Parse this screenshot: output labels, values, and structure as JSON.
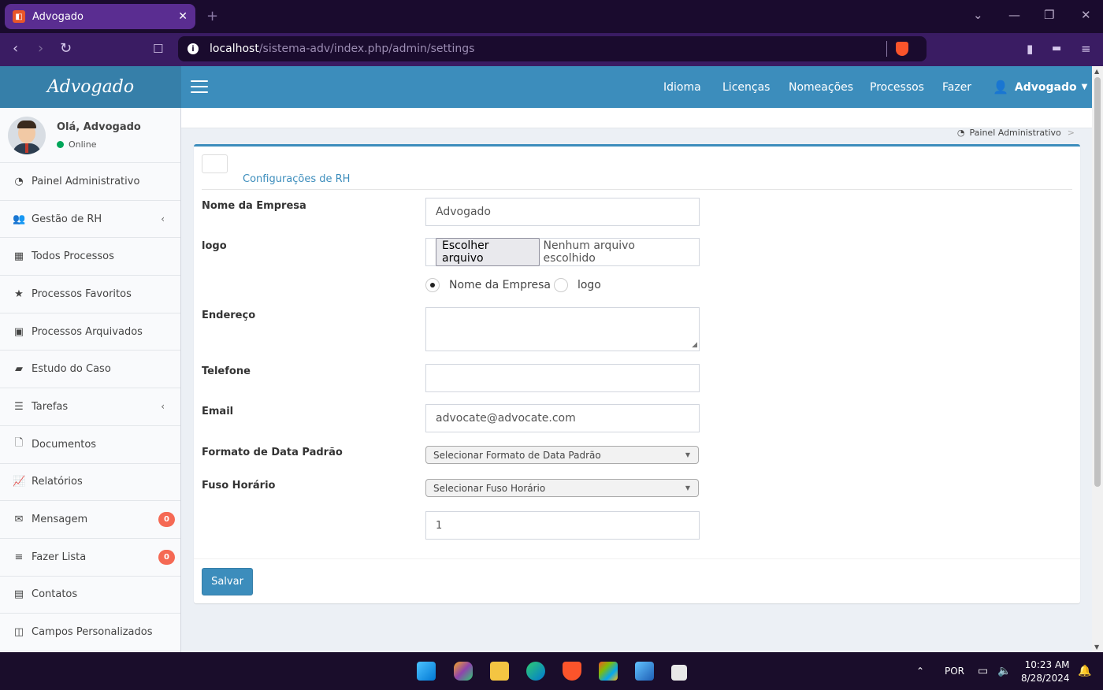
{
  "browser": {
    "tab_title": "Advogado",
    "tab_close": "✕",
    "new_tab": "+",
    "url_host": "localhost",
    "url_path": "/sistema-adv/index.php/admin/settings"
  },
  "app": {
    "brand": "Advogado",
    "nav": [
      "Idioma",
      "Licenças",
      "Nomeações",
      "Processos",
      "Fazer"
    ],
    "user_menu": "Advogado"
  },
  "sidebar": {
    "greeting": "Olá, Advogado",
    "status": "Online",
    "items": [
      {
        "label": "Painel Administrativo",
        "icon": "dashboard-icon"
      },
      {
        "label": "Gestão de RH",
        "icon": "users-icon",
        "expandable": true
      },
      {
        "label": "Todos Processos",
        "icon": "grid-icon"
      },
      {
        "label": "Processos Favoritos",
        "icon": "star-icon"
      },
      {
        "label": "Processos Arquivados",
        "icon": "archive-icon"
      },
      {
        "label": "Estudo do Caso",
        "icon": "book-icon"
      },
      {
        "label": "Tarefas",
        "icon": "tasks-icon",
        "expandable": true
      },
      {
        "label": "Documentos",
        "icon": "file-icon"
      },
      {
        "label": "Relatórios",
        "icon": "line-chart-icon"
      },
      {
        "label": "Mensagem",
        "icon": "envelope-icon",
        "badge": "0"
      },
      {
        "label": "Fazer Lista",
        "icon": "list-icon",
        "badge": "0"
      },
      {
        "label": "Contatos",
        "icon": "address-card-icon"
      },
      {
        "label": "Campos Personalizados",
        "icon": "columns-icon"
      }
    ]
  },
  "breadcrumb": {
    "current": "Painel Administrativo"
  },
  "form": {
    "title": "Configurações de RH",
    "company_label": "Nome da Empresa",
    "company_value": "Advogado",
    "logo_label": "logo",
    "file_button": "Escolher arquivo",
    "file_status": "Nenhum arquivo escolhido",
    "radio_company": "Nome da Empresa",
    "radio_logo": "logo",
    "address_label": "Endereço",
    "phone_label": "Telefone",
    "email_label": "Email",
    "email_value": "advocate@advocate.com",
    "date_format_label": "Formato de Data Padrão",
    "date_format_value": "Selecionar Formato de Data Padrão",
    "timezone_label": "Fuso Horário",
    "timezone_value": "Selecionar Fuso Horário",
    "extra_value": "1",
    "save": "Salvar"
  },
  "taskbar": {
    "lang": "POR",
    "time": "10:23 AM",
    "date": "8/28/2024"
  },
  "colors": {
    "primary": "#3c8dbc",
    "primary_dark": "#367fa9",
    "badge": "#f56954",
    "online": "#00a65a"
  }
}
